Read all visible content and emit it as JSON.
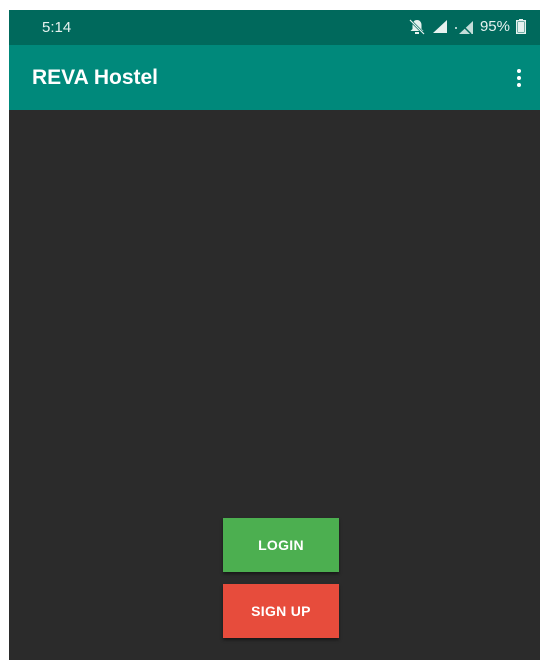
{
  "status_bar": {
    "time": "5:14",
    "battery": "95%",
    "icons": [
      "notifications-off-icon",
      "signal-icon",
      "no-data-signal-icon",
      "battery-icon"
    ]
  },
  "app_bar": {
    "title": "REVA Hostel",
    "menu_icon": "overflow-menu-icon"
  },
  "actions": {
    "login_label": "LOGIN",
    "signup_label": "SIGN UP"
  },
  "colors": {
    "status_bar": "#00695c",
    "app_bar": "#00897b",
    "background": "#2b2b2b",
    "login": "#4caf50",
    "signup": "#e74c3c"
  }
}
